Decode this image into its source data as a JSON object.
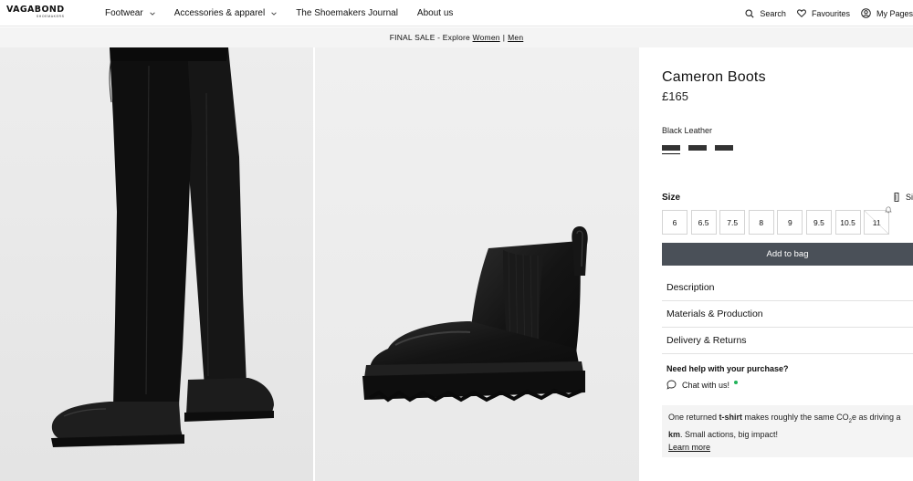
{
  "header": {
    "logo": {
      "main": "VAGABOND",
      "sub": "SHOEMAKERS"
    },
    "nav": [
      {
        "label": "Footwear",
        "has_dropdown": true
      },
      {
        "label": "Accessories & apparel",
        "has_dropdown": true
      },
      {
        "label": "The Shoemakers Journal",
        "has_dropdown": false
      },
      {
        "label": "About us",
        "has_dropdown": false
      }
    ],
    "search": "Search",
    "favourites": "Favourites",
    "my_pages": "My Pages"
  },
  "announcement": {
    "text": "FINAL SALE - Explore ",
    "link_women": "Women",
    "separator": "|",
    "link_men": "Men"
  },
  "product": {
    "title": "Cameron Boots",
    "price": "£165",
    "color": "Black Leather",
    "swatch_color": "#333333",
    "size_label": "Size",
    "size_guide": "Si",
    "sizes": [
      "6",
      "6.5",
      "7.5",
      "8",
      "9",
      "9.5",
      "10.5",
      "11"
    ],
    "sold_out_sizes": [
      "11"
    ],
    "add_to_bag": "Add to bag",
    "accordions": [
      "Description",
      "Materials & Production",
      "Delivery & Returns"
    ],
    "help_title": "Need help with your purchase?",
    "chat": "Chat with us!",
    "chat_status_color": "#21b35a",
    "eco": {
      "p1": "One returned ",
      "b1": "t-shirt",
      "p2": " makes roughly the same CO",
      "sub": "2",
      "p3": "e as driving a",
      "b2": "km",
      "p4": ". Small actions, big impact!",
      "learn_more": "Learn more"
    }
  },
  "colors": {
    "button_bg": "#4a5058",
    "announcement_bg": "#f4f4f4"
  }
}
